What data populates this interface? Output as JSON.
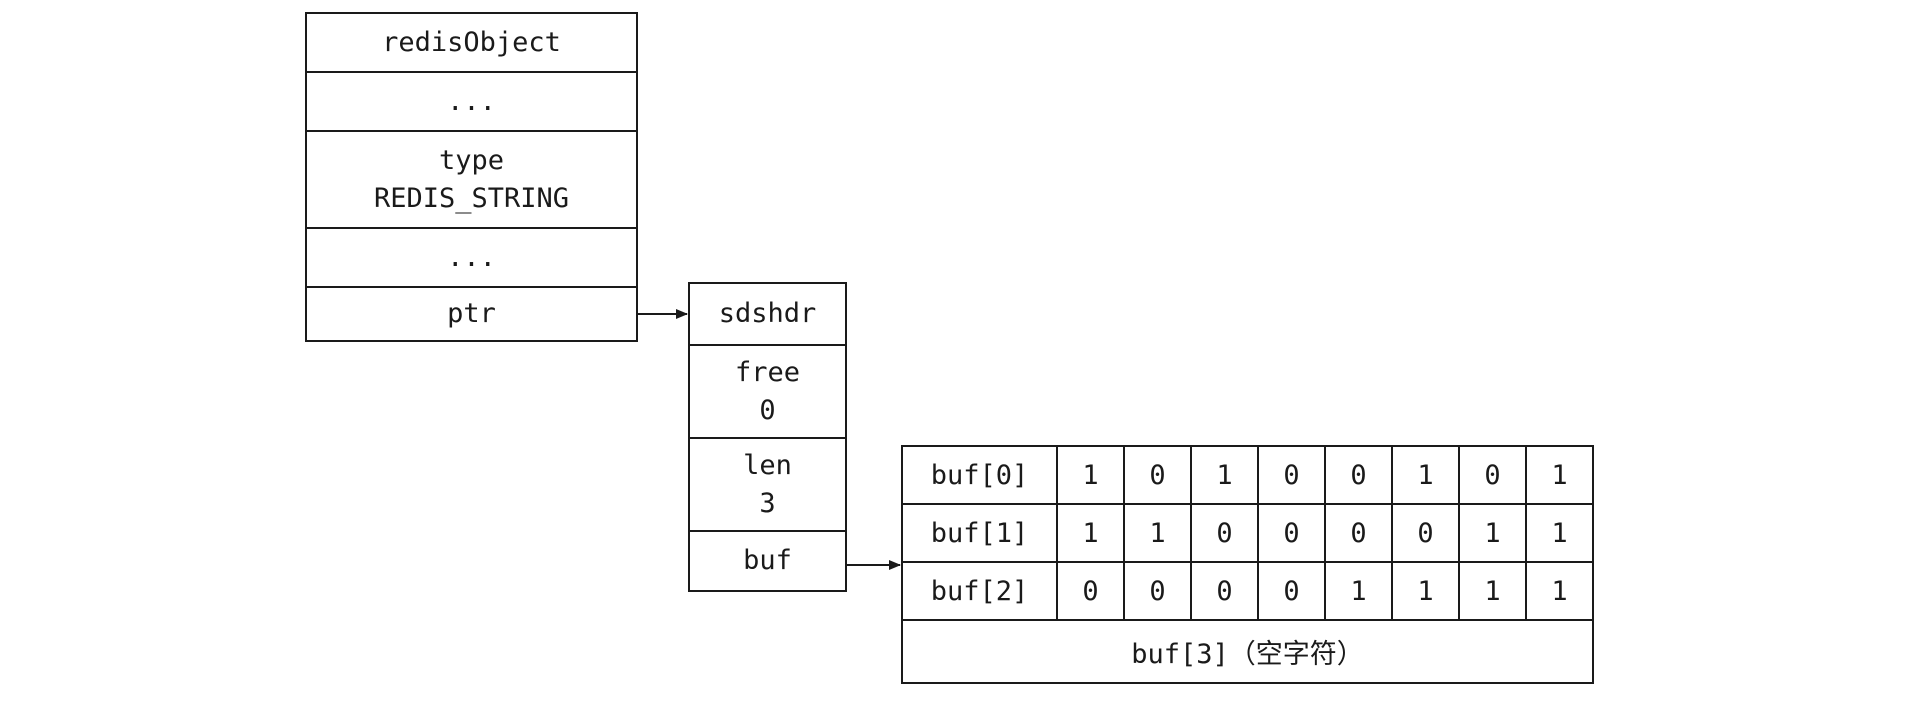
{
  "redis_object": {
    "title": "redisObject",
    "ellipsis_top": "...",
    "type_label": "type",
    "type_value": "REDIS_STRING",
    "ellipsis_bottom": "...",
    "ptr_label": "ptr"
  },
  "sdshdr": {
    "title": "sdshdr",
    "free_label": "free",
    "free_value": "0",
    "len_label": "len",
    "len_value": "3",
    "buf_label": "buf"
  },
  "buf_array": {
    "rows": [
      {
        "label": "buf[0]",
        "bits": [
          "1",
          "0",
          "1",
          "0",
          "0",
          "1",
          "0",
          "1"
        ]
      },
      {
        "label": "buf[1]",
        "bits": [
          "1",
          "1",
          "0",
          "0",
          "0",
          "0",
          "1",
          "1"
        ]
      },
      {
        "label": "buf[2]",
        "bits": [
          "0",
          "0",
          "0",
          "0",
          "1",
          "1",
          "1",
          "1"
        ]
      }
    ],
    "terminator": "buf[3]（空字符）"
  }
}
